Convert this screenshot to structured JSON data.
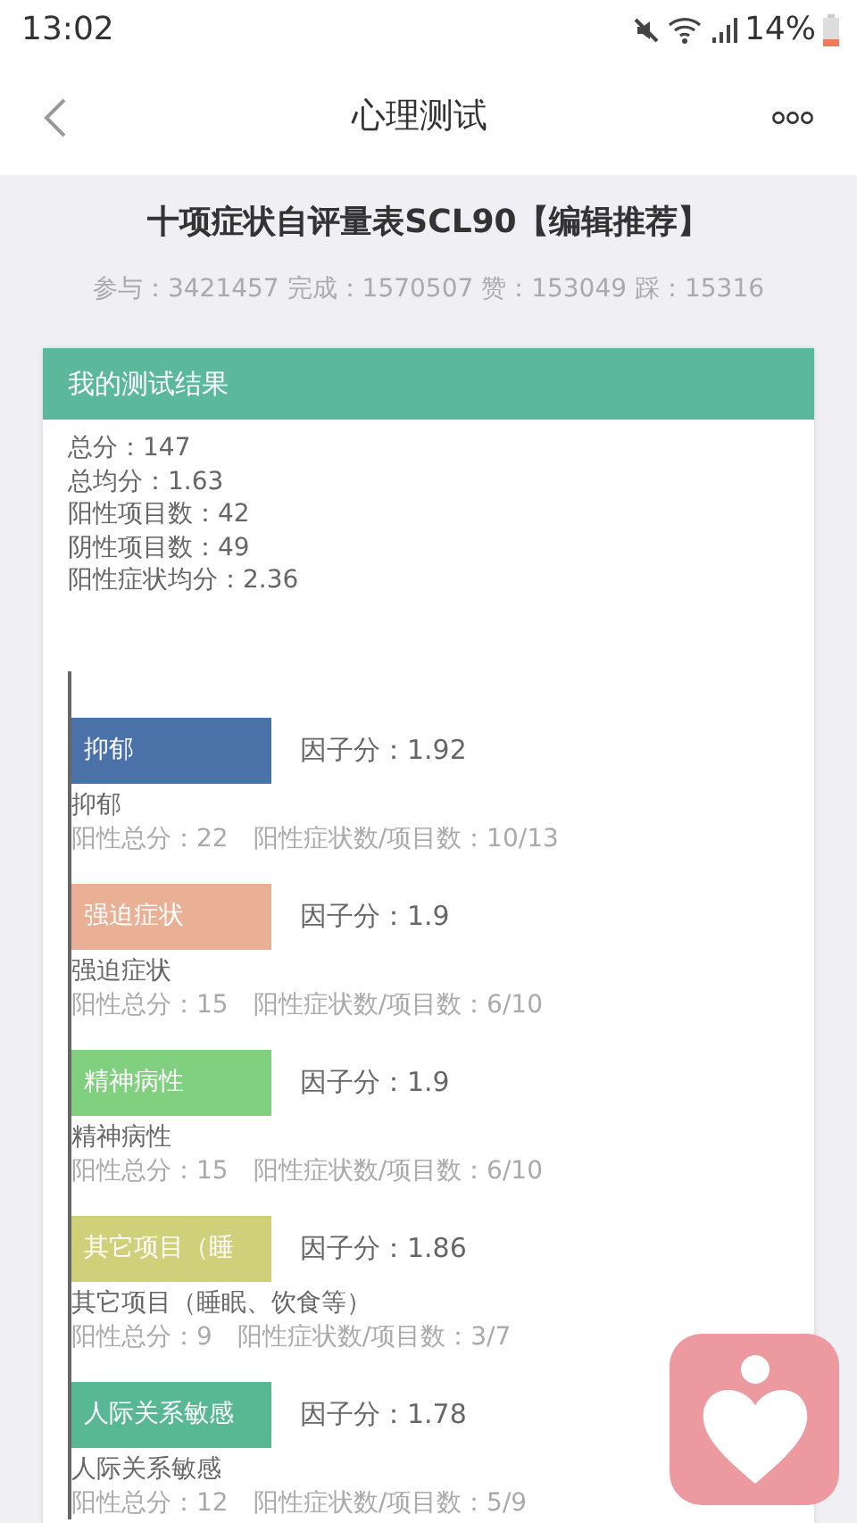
{
  "status_bar": {
    "time": "13:02",
    "battery": "14%"
  },
  "header": {
    "title": "心理测试"
  },
  "test": {
    "title": "十项症状自评量表SCL90【编辑推荐】",
    "stats": "参与：3421457 完成：1570507 赞：153049 踩：15316"
  },
  "result_card": {
    "title": "我的测试结果",
    "summary": [
      "总分：147",
      "总均分：1.63",
      "阳性项目数：42",
      "阴性项目数：49",
      "阳性症状均分：2.36"
    ],
    "factors": [
      {
        "bar_label": "抑郁",
        "color": "#4a72a8",
        "score": "因子分：1.92",
        "name": "抑郁",
        "detail": "阳性总分：22　阳性症状数/项目数：10/13"
      },
      {
        "bar_label": "强迫症状",
        "color": "#e9b096",
        "score": "因子分：1.9",
        "name": "强迫症状",
        "detail": "阳性总分：15　阳性症状数/项目数：6/10"
      },
      {
        "bar_label": "精神病性",
        "color": "#80d07f",
        "score": "因子分：1.9",
        "name": "精神病性",
        "detail": "阳性总分：15　阳性症状数/项目数：6/10"
      },
      {
        "bar_label": "其它项目（睡",
        "color": "#d0d07a",
        "score": "因子分：1.86",
        "name": "其它项目（睡眠、饮食等）",
        "detail": "阳性总分：9　阳性症状数/项目数：3/7"
      },
      {
        "bar_label": "人际关系敏感",
        "color": "#58b893",
        "score": "因子分：1.78",
        "name": "人际关系敏感",
        "detail": "阳性总分：12　阳性症状数/项目数：5/9"
      }
    ]
  }
}
